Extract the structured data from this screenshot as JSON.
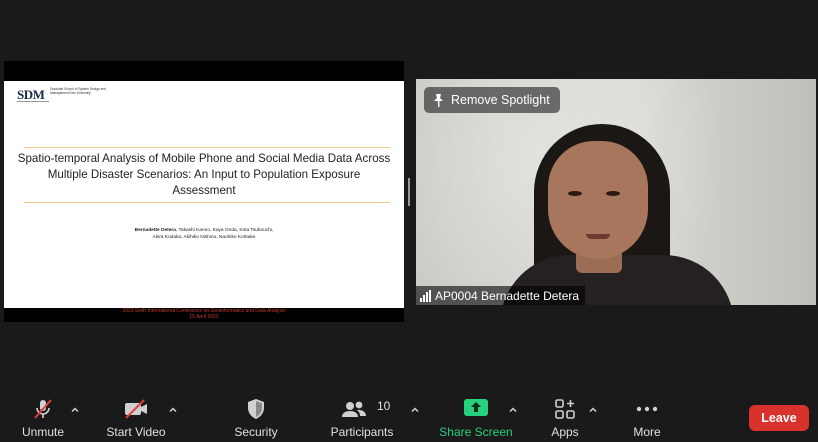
{
  "slide": {
    "logo_mark": "SDM",
    "logo_text": "Graduate School of System Design and Management Keio University",
    "title": "Spatio-temporal Analysis of Mobile Phone and Social Media Data Across Multiple Disaster Scenarios: An Input to Population Exposure Assessment",
    "lead_author": "Bernadette Detera",
    "authors_rest": ", Takashi Kanno, Kaya Onda, Kota Tsubouchi,",
    "authors_line2": "Akira Kodaka, Akihiko Nishino, Naohiko Kohtake",
    "conference": "2023 Sixth International Conference on Geoinformatics and Data Analysis",
    "date": "15 April 2023",
    "accent_color": "#c0392b"
  },
  "video": {
    "spotlight_label": "Remove Spotlight",
    "participant_name": "AP0004 Bernadette Detera",
    "pin_icon": "pin-icon",
    "signal_icon": "signal-icon"
  },
  "toolbar": {
    "unmute": "Unmute",
    "start_video": "Start Video",
    "security": "Security",
    "participants": "Participants",
    "participants_count": "10",
    "share_screen": "Share Screen",
    "apps": "Apps",
    "more": "More",
    "leave": "Leave",
    "share_color": "#26d07c",
    "leave_color": "#d9312b"
  }
}
